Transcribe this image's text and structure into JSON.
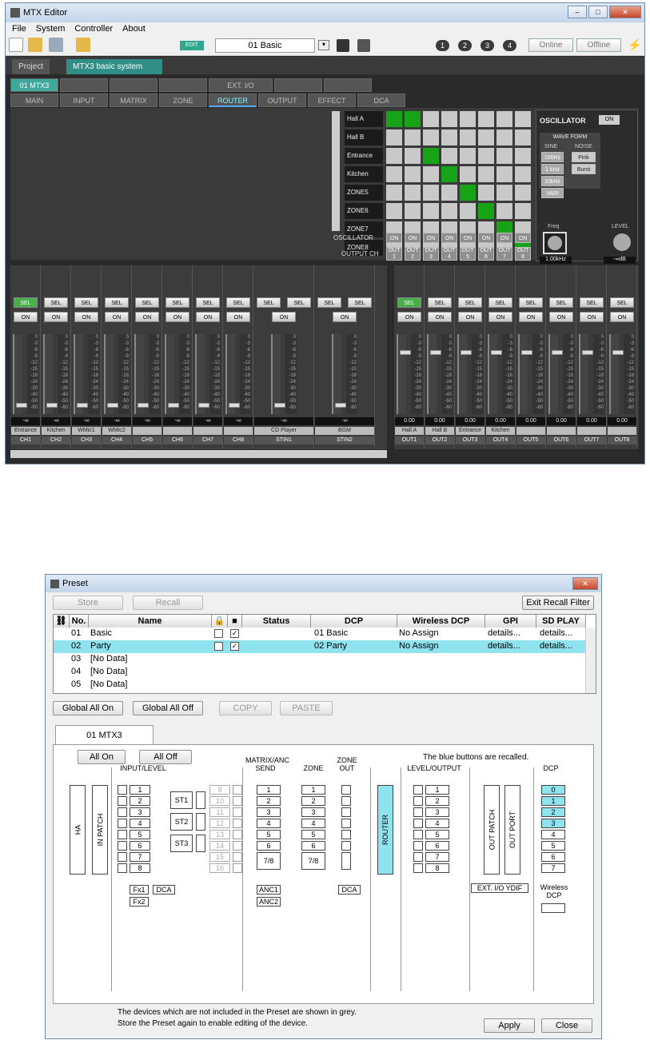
{
  "mtx": {
    "title": "MTX Editor",
    "menu": [
      "File",
      "System",
      "Controller",
      "About"
    ],
    "edit_badge": "EDIT",
    "preset_select": "01 Basic",
    "units": [
      "1",
      "2",
      "3",
      "4"
    ],
    "online": "Online",
    "offline": "Offline",
    "tabs": [
      "Project",
      "MTX3 basic system"
    ],
    "device_tabs": [
      "01 MTX3",
      "",
      "",
      "",
      "EXT. I/O",
      "",
      ""
    ],
    "views": [
      "MAIN",
      "INPUT",
      "MATRIX",
      "ZONE",
      "ROUTER",
      "OUTPUT",
      "EFFECT",
      "DCA"
    ],
    "router_rows": [
      "Hall A",
      "Hall B",
      "Entrance",
      "Kitchen",
      "ZONE5",
      "ZONE6",
      "ZONE7",
      "ZONE8"
    ],
    "router_on": [
      [
        0,
        0
      ],
      [
        0,
        1
      ],
      [
        2,
        2
      ],
      [
        3,
        3
      ],
      [
        4,
        4
      ],
      [
        5,
        5
      ],
      [
        6,
        6
      ],
      [
        7,
        7
      ]
    ],
    "oscillator_label": "OSCILLATOR",
    "output_ch_label": "OUTPUT CH",
    "osc_on": "ON",
    "out_labels": [
      "OUT 1",
      "OUT 2",
      "OUT 3",
      "OUT 4",
      "OUT 5",
      "OUT 6",
      "OUT 7",
      "OUT 8"
    ],
    "osc_panel": {
      "title": "OSCILLATOR",
      "on": "ON",
      "waveform": "WAVE FORM",
      "sine": "SINE",
      "noise": "NOISE",
      "sine_btns": [
        "100Hz",
        "1 kHz",
        "10kHz",
        "VARI"
      ],
      "noise_btns": [
        "Pink",
        "Burst"
      ],
      "freq": "Freq",
      "freq_val": "1.00kHz",
      "level": "LEVEL",
      "level_val": "-∞dB"
    },
    "sel": "SEL",
    "on": "ON",
    "meter_scale": "0\n-3\n-6\n-9\n-12\n-15\n-18\n-24\n-30\n-40\n-50\n-60",
    "inputs": [
      {
        "val": "-∞",
        "name": "Entrance",
        "ch": "CH1"
      },
      {
        "val": "-∞",
        "name": "Kitchen",
        "ch": "CH2"
      },
      {
        "val": "-∞",
        "name": "WMic1",
        "ch": "CH3"
      },
      {
        "val": "-∞",
        "name": "WMic2",
        "ch": "CH4"
      },
      {
        "val": "-∞",
        "name": "",
        "ch": "CH5"
      },
      {
        "val": "-∞",
        "name": "",
        "ch": "CH6"
      },
      {
        "val": "-∞",
        "name": "",
        "ch": "CH7"
      },
      {
        "val": "-∞",
        "name": "",
        "ch": "CH8"
      }
    ],
    "stereo": [
      {
        "val": "-∞",
        "name": "CD Player",
        "ch": "STIN1"
      },
      {
        "val": "-∞",
        "name": "BGM",
        "ch": "STIN2"
      }
    ],
    "outputs": [
      {
        "val": "0.00",
        "name": "Hall A",
        "ch": "OUT1"
      },
      {
        "val": "0.00",
        "name": "Hall B",
        "ch": "OUT2"
      },
      {
        "val": "0.00",
        "name": "Entrance",
        "ch": "OUT3"
      },
      {
        "val": "0.00",
        "name": "Kitchen",
        "ch": "OUT4"
      },
      {
        "val": "0.00",
        "name": "",
        "ch": "OUT5"
      },
      {
        "val": "0.00",
        "name": "",
        "ch": "OUT6"
      },
      {
        "val": "0.00",
        "name": "",
        "ch": "OUT7"
      },
      {
        "val": "0.00",
        "name": "",
        "ch": "OUT8"
      }
    ]
  },
  "preset": {
    "title": "Preset",
    "store": "Store",
    "recall": "Recall",
    "exit_filter": "Exit Recall Filter",
    "headers": [
      "No.",
      "Name",
      "Status",
      "DCP",
      "Wireless DCP",
      "GPI",
      "SD PLAY"
    ],
    "rows": [
      {
        "no": "01",
        "name": "Basic",
        "dcp": "01 Basic",
        "wdcp": "No Assign",
        "gpi": "details...",
        "sd": "details...",
        "checks": true
      },
      {
        "no": "02",
        "name": "Party",
        "dcp": "02 Party",
        "wdcp": "No Assign",
        "gpi": "details...",
        "sd": "details...",
        "checks": true
      },
      {
        "no": "03",
        "name": "[No Data]",
        "checks": false
      },
      {
        "no": "04",
        "name": "[No Data]",
        "checks": false
      },
      {
        "no": "05",
        "name": "[No Data]",
        "checks": false
      },
      {
        "no": "06",
        "name": "[No Data]",
        "checks": false
      }
    ],
    "global_on": "Global All On",
    "global_off": "Global All Off",
    "copy": "COPY",
    "paste": "PASTE",
    "tab": "01 MTX3",
    "all_on": "All On",
    "all_off": "All Off",
    "blue_note": "The blue buttons are recalled.",
    "sections": {
      "input": "INPUT/LEVEL",
      "matrix": "MATRIX/ANC SEND",
      "zone": "ZONE",
      "zone_out": "ZONE OUT",
      "level_out": "LEVEL/OUTPUT",
      "dcp": "DCP"
    },
    "ha": "HA",
    "in_patch": "IN PATCH",
    "router": "ROUTER",
    "out_patch": "OUT PATCH",
    "out_port": "OUT PORT",
    "input_nums": [
      "1",
      "2",
      "3",
      "4",
      "5",
      "6",
      "7",
      "8"
    ],
    "input_grey": [
      "9",
      "10",
      "11",
      "12",
      "13",
      "14",
      "15",
      "16"
    ],
    "st": [
      "ST1",
      "ST2",
      "ST3"
    ],
    "fx": [
      "Fx1",
      "Fx2",
      "DCA"
    ],
    "matrix_nums": [
      "1",
      "2",
      "3",
      "4",
      "5",
      "6",
      "7/8"
    ],
    "anc": [
      "ANC1",
      "ANC2"
    ],
    "zone_dca": "DCA",
    "ext": "EXT. I/O YDIF",
    "dcp_nums": [
      "0",
      "1",
      "2",
      "3",
      "4",
      "5",
      "6",
      "7"
    ],
    "wireless": "Wireless DCP",
    "footer1": "The devices which are not included in the Preset are shown in grey.",
    "footer2": "Store the Preset again to enable editing of the device.",
    "apply": "Apply",
    "close": "Close"
  }
}
